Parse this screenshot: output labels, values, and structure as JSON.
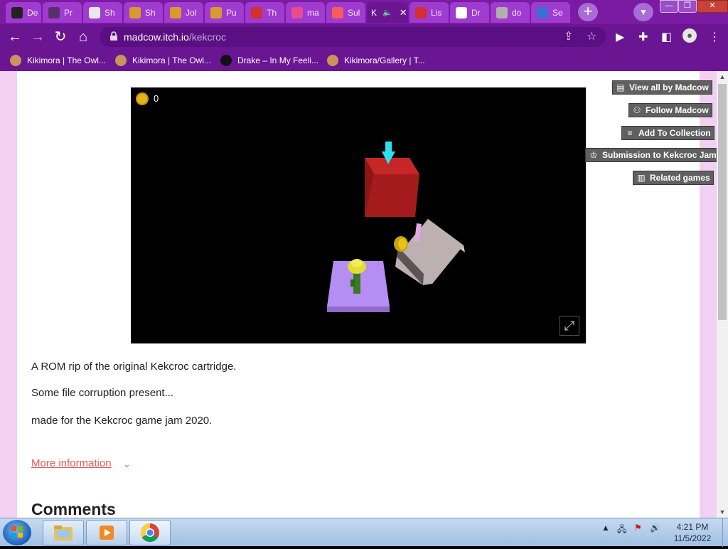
{
  "browser": {
    "tabs": [
      {
        "label": "De",
        "favicon_color": "#222222"
      },
      {
        "label": "Pr",
        "favicon_color": "#5a2f6e"
      },
      {
        "label": "Sh",
        "favicon_color": "#e8e8e8"
      },
      {
        "label": "Sh",
        "favicon_color": "#d99a2b"
      },
      {
        "label": "Jol",
        "favicon_color": "#d99a2b"
      },
      {
        "label": "Pu",
        "favicon_color": "#d99a2b"
      },
      {
        "label": "Th",
        "favicon_color": "#d32f2f"
      },
      {
        "label": "ma",
        "favicon_color": "#e74c8c"
      },
      {
        "label": "Sul",
        "favicon_color": "#fa5c5c"
      },
      {
        "label": "K",
        "favicon_color": "#fa5c5c",
        "active": true
      },
      {
        "label": "Lis",
        "favicon_color": "#d32f2f"
      },
      {
        "label": "Dr",
        "favicon_color": "#ffffff"
      },
      {
        "label": "do",
        "favicon_color": "#b0b0b0"
      },
      {
        "label": "Se",
        "favicon_color": "#3b6fd0"
      }
    ],
    "address": {
      "host": "madcow.itch.io",
      "path": "/kekcroc"
    },
    "bookmarks": [
      {
        "label": "Kikimora | The Owl...",
        "favicon_color": "#c8955a"
      },
      {
        "label": "Kikimora | The Owl...",
        "favicon_color": "#c8955a"
      },
      {
        "label": "Drake – In My Feeli...",
        "favicon_color": "#111111"
      },
      {
        "label": "Kikimora/Gallery | T...",
        "favicon_color": "#c8955a"
      }
    ]
  },
  "game": {
    "coin_count": "0"
  },
  "sidebar_buttons": [
    {
      "label": "View all by Madcow",
      "icon": "store-icon"
    },
    {
      "label": "Follow Madcow",
      "icon": "follow-icon"
    },
    {
      "label": "Add To Collection",
      "icon": "collection-icon"
    },
    {
      "label": "Submission to Kekcroc Jam",
      "icon": "ribbon-icon"
    },
    {
      "label": "Related games",
      "icon": "map-icon"
    }
  ],
  "description": {
    "line1": "A ROM rip of the original Kekcroc cartridge.",
    "line2": "Some file corruption present...",
    "line3": "made for the Kekcroc game jam 2020."
  },
  "more_info_label": "More information",
  "comments_heading": "Comments",
  "taskbar": {
    "time": "4:21 PM",
    "date": "11/5/2022"
  },
  "colors": {
    "accent": "#fa5c5c",
    "browser_theme": "#6a1693",
    "page_bg": "#f2d0f3"
  }
}
